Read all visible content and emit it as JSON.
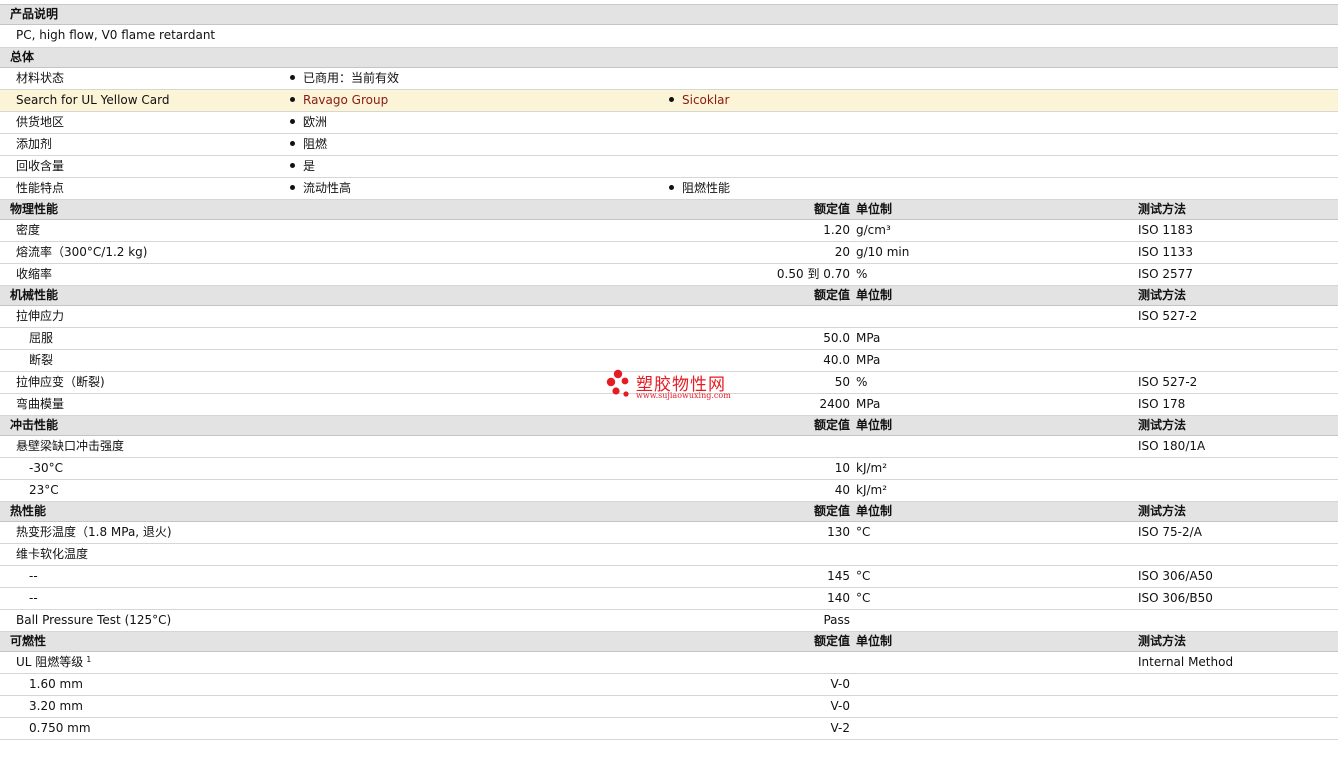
{
  "sections": {
    "desc": {
      "title": "产品说明",
      "text": "PC, high flow, V0 flame retardant"
    },
    "general": {
      "title": "总体",
      "rows": [
        {
          "label": "材料状态",
          "b1": "已商用：当前有效"
        },
        {
          "label": "Search for UL Yellow Card",
          "b1": "Ravago Group",
          "b2": "Sicoklar"
        },
        {
          "label": "供货地区",
          "b1": "欧洲"
        },
        {
          "label": "添加剂",
          "b1": "阻燃"
        },
        {
          "label": "回收含量",
          "b1": "是"
        },
        {
          "label": "性能特点",
          "b1": "流动性高",
          "b2": "阻燃性能"
        }
      ]
    },
    "headers": {
      "nominal": "额定值",
      "unit": "单位制",
      "method": "测试方法"
    },
    "physical": {
      "title": "物理性能",
      "rows": [
        {
          "label": "密度",
          "value": "1.20",
          "unit": "g/cm³",
          "method": "ISO 1183"
        },
        {
          "label": "熔流率（300°C/1.2 kg)",
          "value": "20",
          "unit": "g/10 min",
          "method": "ISO 1133"
        },
        {
          "label": "收缩率",
          "value": "0.50 到  0.70",
          "unit": "%",
          "method": "ISO 2577"
        }
      ]
    },
    "mechanical": {
      "title": "机械性能",
      "rows": [
        {
          "label": "拉伸应力",
          "value": "",
          "unit": "",
          "method": "ISO 527-2"
        },
        {
          "label": "屈服",
          "value": "50.0",
          "unit": "MPa",
          "method": "",
          "sub": true
        },
        {
          "label": "断裂",
          "value": "40.0",
          "unit": "MPa",
          "method": "",
          "sub": true
        },
        {
          "label": "拉伸应变（断裂)",
          "value": "50",
          "unit": "%",
          "method": "ISO 527-2"
        },
        {
          "label": "弯曲模量",
          "value": "2400",
          "unit": "MPa",
          "method": "ISO 178"
        }
      ]
    },
    "impact": {
      "title": "冲击性能",
      "rows": [
        {
          "label": "悬壁梁缺口冲击强度",
          "value": "",
          "unit": "",
          "method": "ISO 180/1A"
        },
        {
          "label": "-30°C",
          "value": "10",
          "unit": "kJ/m²",
          "method": "",
          "sub": true
        },
        {
          "label": "23°C",
          "value": "40",
          "unit": "kJ/m²",
          "method": "",
          "sub": true
        }
      ]
    },
    "thermal": {
      "title": "热性能",
      "rows": [
        {
          "label": "热变形温度（1.8 MPa, 退火)",
          "value": "130",
          "unit": "°C",
          "method": "ISO 75-2/A"
        },
        {
          "label": "维卡软化温度",
          "value": "",
          "unit": "",
          "method": ""
        },
        {
          "label": "--",
          "value": "145",
          "unit": "°C",
          "method": "ISO 306/A50",
          "sub": true
        },
        {
          "label": "--",
          "value": "140",
          "unit": "°C",
          "method": "ISO 306/B50",
          "sub": true
        },
        {
          "label": "Ball Pressure Test (125°C)",
          "value": "Pass",
          "unit": "",
          "method": ""
        }
      ]
    },
    "flammability": {
      "title": "可燃性",
      "rows": [
        {
          "label": "UL 阻燃等级",
          "sup": "1",
          "value": "",
          "unit": "",
          "method": "Internal Method"
        },
        {
          "label": "1.60 mm",
          "value": "V-0",
          "unit": "",
          "method": "",
          "sub": true
        },
        {
          "label": "3.20 mm",
          "value": "V-0",
          "unit": "",
          "method": "",
          "sub": true
        },
        {
          "label": "0.750 mm",
          "value": "V-2",
          "unit": "",
          "method": "",
          "sub": true
        }
      ]
    }
  },
  "watermark": {
    "title": "塑胶物性网",
    "url": "www.sujiaowuxing.com"
  },
  "colors": {
    "link": "#8a1a14",
    "highlight": "#fbf4d6",
    "section_bg": "#e3e3e3",
    "watermark": "#e51c23"
  }
}
